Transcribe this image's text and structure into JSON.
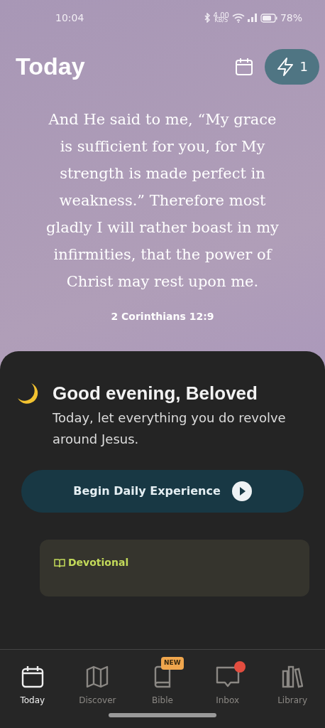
{
  "status_bar": {
    "time": "10:04",
    "net_speed": "4.00",
    "net_unit": "KB/S",
    "battery": "78%"
  },
  "header": {
    "title": "Today",
    "streak_count": "1"
  },
  "verse": {
    "text": "And He said to me, “My grace is sufficient for you, for My strength is made perfect in weakness.” Therefore most gladly I will rather boast in my infirmities, that the power of Christ may rest upon me.",
    "reference": "2 Corinthians 12:9"
  },
  "greeting": {
    "title": "Good evening, Beloved",
    "subtitle": "Today, let everything you do revolve around Jesus.",
    "button": "Begin Daily Experience"
  },
  "devotional_card": {
    "label": "Devotional"
  },
  "tabs": [
    {
      "label": "Today",
      "kind": "calendar",
      "selected": true
    },
    {
      "label": "Discover",
      "kind": "map",
      "selected": false
    },
    {
      "label": "Bible",
      "kind": "book",
      "selected": false,
      "badge": "NEW"
    },
    {
      "label": "Inbox",
      "kind": "chat",
      "selected": false,
      "unread": true
    },
    {
      "label": "Library",
      "kind": "library",
      "selected": false
    }
  ]
}
